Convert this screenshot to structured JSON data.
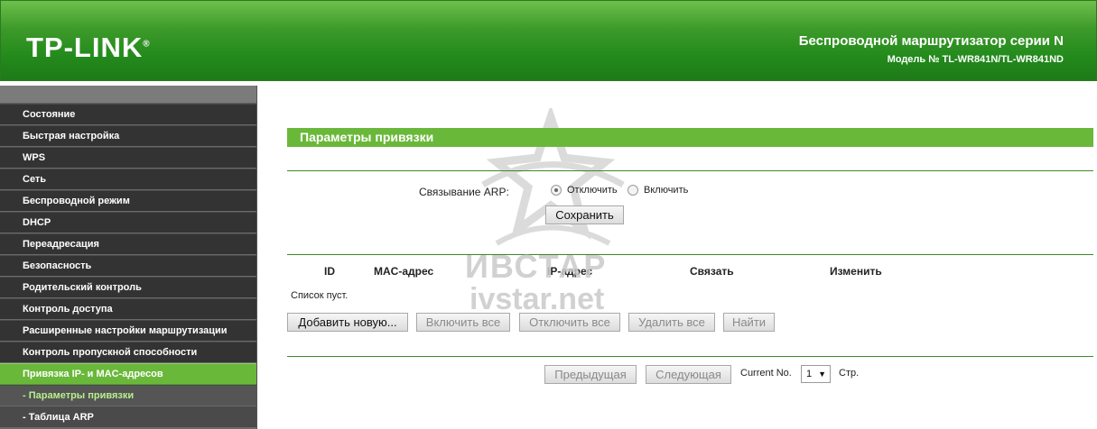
{
  "header": {
    "logo": "TP-LINK",
    "logo_mark": "®",
    "product_title": "Беспроводной маршрутизатор серии N",
    "model_title": "Модель № TL-WR841N/TL-WR841ND"
  },
  "sidebar": {
    "items": [
      {
        "label": "Состояние"
      },
      {
        "label": "Быстрая настройка"
      },
      {
        "label": "WPS"
      },
      {
        "label": "Сеть"
      },
      {
        "label": "Беспроводной режим"
      },
      {
        "label": "DHCP"
      },
      {
        "label": "Переадресация"
      },
      {
        "label": "Безопасность"
      },
      {
        "label": "Родительский контроль"
      },
      {
        "label": "Контроль доступа"
      },
      {
        "label": "Расширенные настройки маршрутизации"
      },
      {
        "label": "Контроль пропускной способности"
      },
      {
        "label": "Привязка IP- и MAC-адресов"
      },
      {
        "label": "- Параметры привязки"
      },
      {
        "label": "- Таблица ARP"
      }
    ]
  },
  "main": {
    "section_title": "Параметры привязки",
    "arp_label": "Связывание ARP:",
    "radio_off": "Отключить",
    "radio_on": "Включить",
    "save_button": "Сохранить",
    "table_headers": [
      "ID",
      "MAC-адрес",
      "IP-адрес",
      "Связать",
      "Изменить"
    ],
    "empty_text": "Список пуст.",
    "buttons": {
      "add_new": "Добавить новую...",
      "enable_all": "Включить все",
      "disable_all": "Отключить все",
      "delete_all": "Удалить все",
      "find": "Найти"
    },
    "pagination": {
      "prev": "Предыдущая",
      "next": "Следующая",
      "current_label": "Current No.",
      "current_value": "1",
      "suffix": "Стр."
    }
  },
  "watermark": {
    "line1": "ИВСТАР",
    "line2": "ivstar.net"
  },
  "colors": {
    "accent_green": "#6ab83a",
    "header_green": "#238a1c",
    "sidebar_dark": "#333333",
    "rule_green": "#3a8a2a"
  }
}
